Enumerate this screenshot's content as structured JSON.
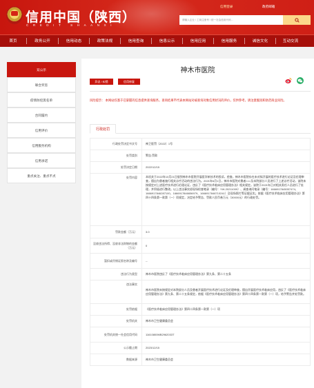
{
  "header": {
    "title": "信用中国（陕西）",
    "subtitle": "CREDIT  SHAANXI",
    "login_link": "信用登录",
    "mail_link": "政府邮箱",
    "search_placeholder": "请输入企业 / 工商注册号 / 统一社会信用代码..."
  },
  "nav": {
    "items": [
      "首页",
      "政务公开",
      "信用动态",
      "政策法规",
      "信用查询",
      "信息公示",
      "信用应用",
      "信用服务",
      "诚信文化",
      "互动交流"
    ]
  },
  "sidebar": {
    "items": [
      "双公示",
      "联合奖惩",
      "疫情防控黑名单",
      "合同履约",
      "信用评价",
      "信用服务机构",
      "信用承诺",
      "重点关注、重点不点"
    ]
  },
  "main": {
    "org_title": "神木市医院",
    "btn_report": "异议 / 纠错",
    "btn_repair": "信用修复",
    "notice": "风险提示：  本网站仅基于已掌握的信息提供查询服务，查询结果不代表本网站对被查询对象信用状况的评价，仅供参考，请注意甄别和防范商业风险。",
    "tab_label": "行政处罚"
  },
  "detail_rows": [
    {
      "label": "行政处罚决定书文号",
      "value": "神卫医罚〔2022〕1号"
    },
    {
      "label": "处罚类别",
      "value": "警告;罚款"
    },
    {
      "label": "处罚决定日期",
      "value": "2022/12/15"
    },
    {
      "label": "处罚内容",
      "value": "本机关于2022年10月21日接到神木市医院开展医学新技术的投诉，经查，神木市医院存在未对拟开展的医疗技术进行论证及伦理审查，擅自为患者施行相关诊疗活动的违法行为。2021年6月1日，神木市医院对患者×××及本院部分人员进行了上述诊疗活动，该院未按规定对上述医疗技术进行伦理论证，违反了《医疗技术临床应用管理办法》相关规定。该院于2021年已对相关责任人员进行了处理，并积极进行整改。以上违法事实经现场检查笔录（编号：YW-20211009）、调查询问笔录（编号：1666917845057474、1666917846287100、1666917846656979、1666917846710241）及现场照片等证据证实。依据《医疗技术临床应用管理办法》第四十四条第一款第（一）项规定，决定给予警告、罚款人民币叁万元（30000元）的行政处罚。"
    },
    {
      "label": "罚款金额（万元）",
      "value": "3.0"
    },
    {
      "label": "没收违法所得、没收非法财物的金额（万元）",
      "value": "0"
    },
    {
      "label": "暂扣或吊销证照名称及编号",
      "value": "--"
    },
    {
      "label": "违法行为类型",
      "value": "神木市医院违反了《医疗技术临床应用管理办法》第九条、第二十五条"
    },
    {
      "label": "违法事实",
      "value": "神木市医院未按规定对本院部分人员及患者开展医疗技术进行论证及伦理审查，擅自开展医疗技术临床应用，违反了《医疗技术临床应用管理办法》第九条、第二十五条规定，依据《医疗技术临床应用管理办法》第四十四条第一款第（一）项，给予警告并处罚款。"
    },
    {
      "label": "处罚依据",
      "value": "《医疗技术临床应用管理办法》第四十四条第一款第（一）项"
    },
    {
      "label": "处罚机关",
      "value": "神木市卫生健康委员会"
    },
    {
      "label": "处罚机关统一社会信用代码",
      "value": "11610800MB2962033T"
    },
    {
      "label": "公示截止期",
      "value": "2023/12/15"
    },
    {
      "label": "数据来源",
      "value": "神木市卫生健康委员会"
    }
  ]
}
